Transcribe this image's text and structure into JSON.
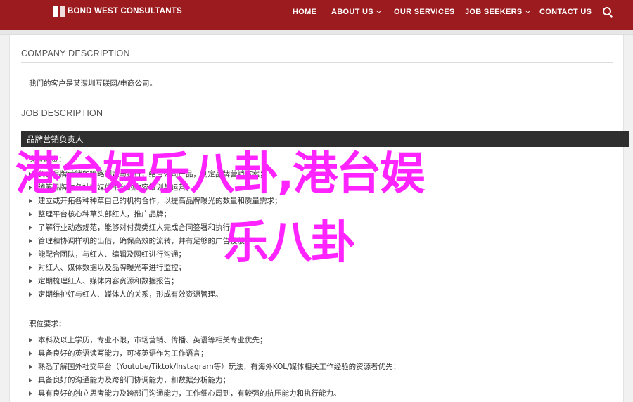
{
  "header": {
    "logo_text": "BOND WEST CONSULTANTS",
    "nav": [
      {
        "label": "HOME",
        "dropdown": false
      },
      {
        "label": "ABOUT US",
        "dropdown": true
      },
      {
        "label": "OUR SERVICES",
        "dropdown": false
      },
      {
        "label": "JOB SEEKERS",
        "dropdown": true
      },
      {
        "label": "CONTACT US",
        "dropdown": false
      }
    ],
    "search_icon": "search-icon",
    "brand_color": "#9b1b1f"
  },
  "company": {
    "title": "COMPANY DESCRIPTION",
    "text": "我们的客户是某深圳互联网/电商公司。"
  },
  "job": {
    "title": "JOB DESCRIPTION",
    "bar_title": "品牌营销负责人",
    "intro": "岗位职责：",
    "duties": [
      "负责品牌营销的策略制定与执行，结合公司产品，制定品牌营销方案；",
      "统筹品牌在各社交媒体平台的内容策划与运营；",
      "建立或开拓各种种草自己的机构合作，以提高品牌曝光的数量和质量需求；",
      "整理平台核心种草头部红人，推广品牌；",
      "了解行业动态规范，能够对付费类红人完成合同签署和执行；",
      "管理和协调样机的出借，确保高效的流转，并有足够的广告投放；",
      "能配合团队，与红人、编辑及网红进行沟通；",
      "对红人、媒体数据以及品牌曝光率进行监控；",
      "定期梳理红人、媒体内容资源和数据报告；",
      "定期维护好与红人、媒体人的关系，形成有效资源管理。"
    ],
    "req_title": "职位要求：",
    "requirements": [
      "本科及以上学历，专业不限，市场营销、传播、英语等相关专业优先；",
      "具备良好的英语读写能力，可将英语作为工作语言；",
      "熟悉了解国外社交平台（Youtube/Tiktok/Instagram等）玩法，有海外KOL/媒体相关工作经验的资源者优先；",
      "具备良好的沟通能力及跨部门协调能力，和数据分析能力；",
      "具有良好的独立思考能力及跨部门沟通能力，工作细心周到，有较强的抗压能力和执行能力。"
    ]
  },
  "overlay": {
    "line1": "港台娱乐八卦,港台娱",
    "line2": "乐八卦",
    "color": "#ff24ff"
  }
}
